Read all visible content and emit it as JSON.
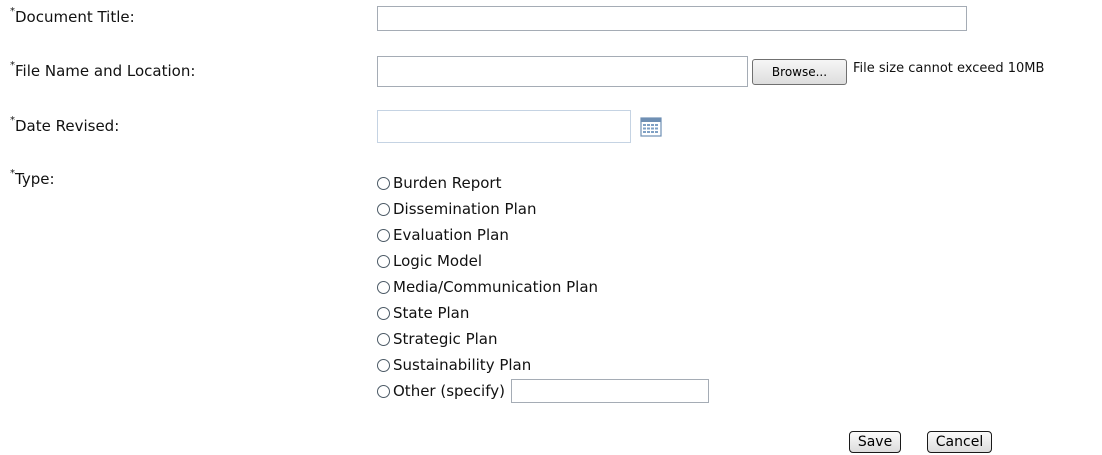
{
  "form": {
    "required_mark": "*",
    "fields": {
      "document_title": {
        "label": "Document Title:",
        "value": ""
      },
      "file_name": {
        "label": "File Name and Location:",
        "value": "",
        "browse_label": "Browse...",
        "note": "File size cannot exceed 10MB"
      },
      "date_revised": {
        "label": "Date Revised:",
        "value": "",
        "icon": "calendar-icon"
      },
      "type": {
        "label": "Type:",
        "options": [
          "Burden Report",
          "Dissemination Plan",
          "Evaluation Plan",
          "Logic Model",
          "Media/Communication Plan",
          "State Plan",
          "Strategic Plan",
          "Sustainability Plan",
          "Other (specify)"
        ],
        "selected": null,
        "other_value": ""
      }
    },
    "actions": {
      "save_label": "Save",
      "cancel_label": "Cancel"
    }
  }
}
